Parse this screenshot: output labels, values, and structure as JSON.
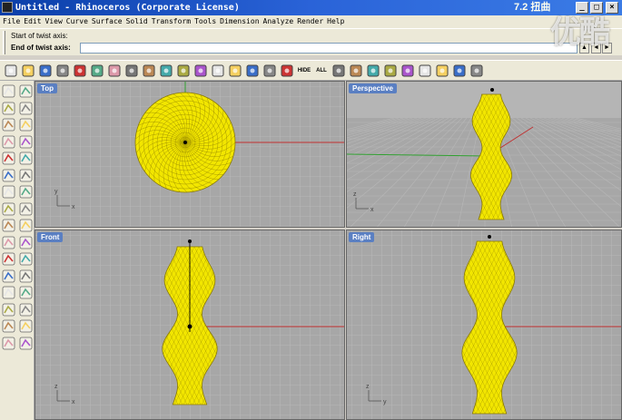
{
  "window": {
    "title": "Untitled - Rhinoceros (Corporate License)",
    "overlay_version": "7.2 扭曲",
    "watermark": "优酷"
  },
  "menu": {
    "items": [
      "File",
      "Edit",
      "View",
      "Curve",
      "Surface",
      "Solid",
      "Transform",
      "Tools",
      "Dimension",
      "Analyze",
      "Render",
      "Help"
    ]
  },
  "command": {
    "history_line": "Start of twist axis:",
    "prompt": "End of twist axis:",
    "input_value": ""
  },
  "toolbar": {
    "icons": [
      "new-file-icon",
      "open-file-icon",
      "save-icon",
      "print-icon",
      "cut-icon",
      "copy-icon",
      "paste-icon",
      "undo-icon",
      "pan-icon",
      "rotate-view-icon",
      "zoom-dynamic-icon",
      "zoom-window-icon",
      "zoom-extents-icon",
      "zoom-selected-icon",
      "four-viewports-icon",
      "red-car-icon",
      "layers-icon",
      "hide-icon",
      "show-all-icon",
      "show-hide-icon",
      "books-icon",
      "color-wheel-icon",
      "sphere-shade-icon",
      "render-icon",
      "sun-icon",
      "light-icon",
      "options-icon",
      "help-icon"
    ],
    "all_label": "ALL",
    "hide_label": "HIDE"
  },
  "left_toolbar": {
    "icons": [
      "select-arrow-icon",
      "point-icon",
      "polyline-icon",
      "curve-icon",
      "circle-icon",
      "arc-icon",
      "polygon-icon",
      "rectangle-icon",
      "ellipse-icon",
      "freeform-curve-icon",
      "surface-icon",
      "extrude-icon",
      "box-icon",
      "sphere-icon",
      "mesh-icon",
      "cylinder-icon",
      "boolean-icon",
      "fillet-icon",
      "join-icon",
      "explode-icon",
      "trim-icon",
      "split-icon",
      "array-icon",
      "mirror-icon",
      "move-icon",
      "scale-icon",
      "text-icon",
      "dimension-icon",
      "group-icon",
      "block-icon",
      "analysis-icon",
      "render-icon"
    ]
  },
  "viewports": {
    "top": {
      "title": "Top"
    },
    "perspective": {
      "title": "Perspective"
    },
    "front": {
      "title": "Front"
    },
    "right": {
      "title": "Right"
    }
  },
  "colors": {
    "object": "#f2e600",
    "wire": "#8a7a00",
    "x_axis": "#c03030",
    "y_axis": "#30a030",
    "viewport_bg": "#a7a7a7",
    "grid": "#b8b8b8"
  }
}
